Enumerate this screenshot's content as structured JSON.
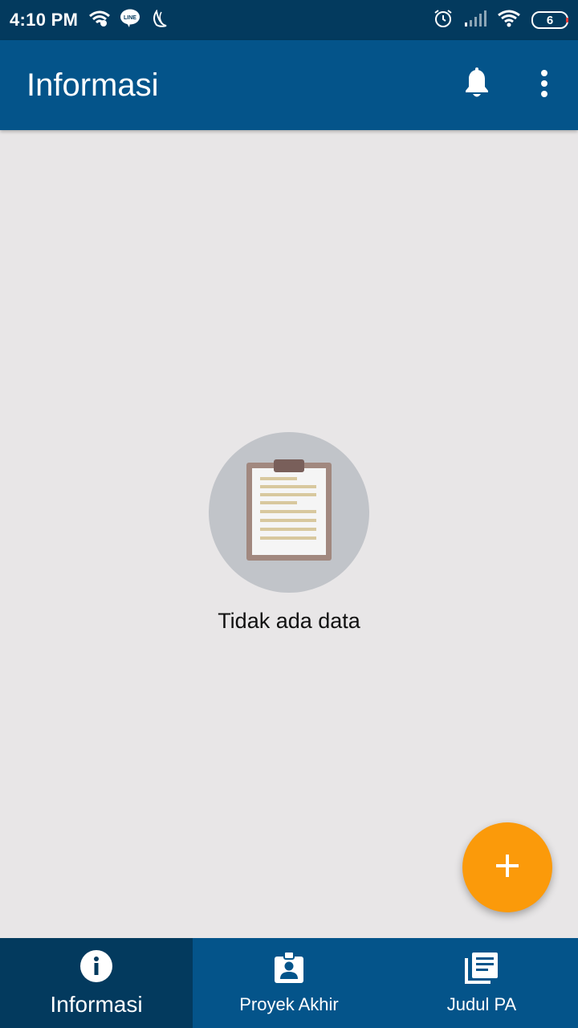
{
  "status_bar": {
    "time": "4:10 PM",
    "left_icons": [
      "wifi-speed-icon",
      "line-icon",
      "moon-icon"
    ],
    "right_icons": [
      "alarm-icon",
      "signal-icon",
      "wifi-icon"
    ],
    "battery": "6"
  },
  "app_bar": {
    "title": "Informasi",
    "actions": [
      "bell-icon",
      "more-vert-icon"
    ]
  },
  "empty_state": {
    "icon": "clipboard-icon",
    "text": "Tidak ada data"
  },
  "fab": {
    "icon": "plus-icon"
  },
  "bottom_nav": {
    "items": [
      {
        "label": "Informasi",
        "icon": "info-icon",
        "active": true
      },
      {
        "label": "Proyek Akhir",
        "icon": "id-badge-icon",
        "active": false
      },
      {
        "label": "Judul PA",
        "icon": "library-books-icon",
        "active": false
      }
    ]
  },
  "colors": {
    "status_bar": "#033a5e",
    "app_bar": "#04548a",
    "nav_active": "#033a5e",
    "background": "#e8e6e7",
    "fab": "#fb9a0a",
    "empty_circle": "#c1c4c9"
  }
}
